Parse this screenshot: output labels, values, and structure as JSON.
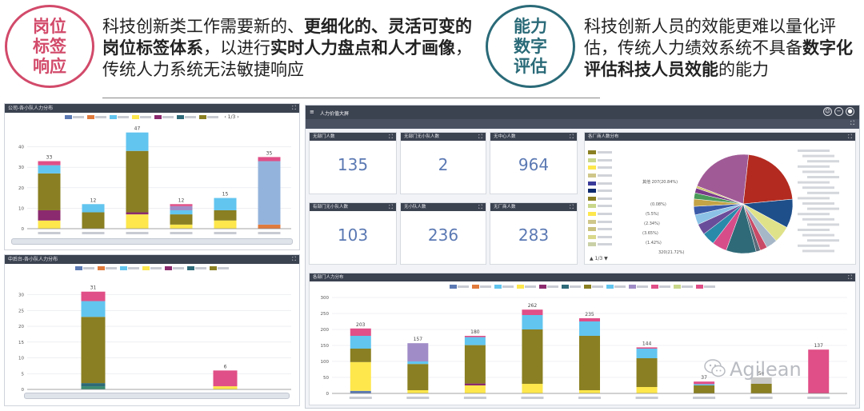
{
  "header": {
    "left_badge": "岗位\n标签\n响应",
    "left_text": [
      "科技创新类工作需要新的、",
      "更细化的、灵活可变的岗位标签体系",
      "，以进行",
      "实时人力盘点和人才画像",
      "，传统人力系统无法敏捷响应"
    ],
    "right_badge": "能力\n数字\n评估",
    "right_text": [
      "科技创新人员的效能更难以量化评估，传统人力绩效系统不具备",
      "数字化评估科技人员效能",
      "的能力"
    ],
    "colors": {
      "left": "#d24a6a",
      "right": "#2a6a78"
    }
  },
  "panels": {
    "top_left": {
      "title": "公司-各小队人力分布",
      "pager": "1/3",
      "chart_data": {
        "type": "bar",
        "stacked": true,
        "ylim": [
          0,
          50
        ],
        "yticks": [
          0,
          10,
          20,
          30,
          40
        ],
        "total_labels": [
          "33",
          "12",
          "47",
          "12",
          "15",
          "35"
        ],
        "bars": [
          {
            "segments": [
              [
                4,
                "#fde74c"
              ],
              [
                5,
                "#8b2a6e"
              ],
              [
                18,
                "#8a7f22"
              ],
              [
                4,
                "#62c5ef"
              ],
              [
                2,
                "#e04f87"
              ]
            ]
          },
          {
            "segments": [
              [
                8,
                "#8a7f22"
              ],
              [
                4,
                "#62c5ef"
              ]
            ]
          },
          {
            "segments": [
              [
                7,
                "#fde74c"
              ],
              [
                1,
                "#8b2a6e"
              ],
              [
                30,
                "#8a7f22"
              ],
              [
                9,
                "#62c5ef"
              ]
            ]
          },
          {
            "segments": [
              [
                2,
                "#fde74c"
              ],
              [
                5,
                "#8a7f22"
              ],
              [
                2,
                "#62c5ef"
              ],
              [
                2,
                "#a08cc7"
              ],
              [
                1,
                "#e04f87"
              ]
            ]
          },
          {
            "segments": [
              [
                4,
                "#fde74c"
              ],
              [
                5,
                "#8a7f22"
              ],
              [
                6,
                "#62c5ef"
              ]
            ]
          },
          {
            "segments": [
              [
                2,
                "#e07a3c"
              ],
              [
                31,
                "#94b3dc"
              ],
              [
                2,
                "#e04f87"
              ]
            ]
          }
        ]
      }
    },
    "bottom_left": {
      "title": "中后台-各小队人力分布",
      "chart_data": {
        "type": "bar",
        "stacked": true,
        "ylim": [
          0,
          36
        ],
        "yticks": [
          0,
          5,
          10,
          15,
          20,
          25,
          30
        ],
        "total_labels": [
          "31",
          "6"
        ],
        "bars": [
          {
            "segments": [
              [
                1,
                "#3a8a72"
              ],
              [
                1,
                "#2e6a78"
              ],
              [
                21,
                "#8a7f22"
              ],
              [
                5,
                "#62c5ef"
              ],
              [
                3,
                "#e04f87"
              ]
            ]
          },
          {
            "segments": [
              [
                1,
                "#fde74c"
              ],
              [
                5,
                "#e04f87"
              ]
            ]
          }
        ]
      }
    },
    "dash": {
      "title": "人力价值大屏",
      "kpis": [
        {
          "title": "无部门人数",
          "value": "135"
        },
        {
          "title": "无部门无小队人数",
          "value": "2"
        },
        {
          "title": "无中心人数",
          "value": "964"
        },
        {
          "title": "有部门无小队人数",
          "value": "103"
        },
        {
          "title": "无小队人数",
          "value": "236"
        },
        {
          "title": "无厂商人数",
          "value": "283"
        }
      ],
      "pie": {
        "title": "各厂商人数分布",
        "pager": "1/3",
        "labels": [
          "其他 207(20.84%)",
          "320(21.72%)",
          "(0.08%)",
          "(5.5%)",
          "(2.34%)",
          "(3.65%)",
          "(1.42%)"
        ],
        "legend_colors": [
          "#8a7f22",
          "#c8d78a",
          "#fde74c",
          "#cfc68a",
          "#3a3a9a",
          "#0e2a6e",
          "#8a7f22",
          "#c8d78a",
          "#fde74c",
          "#cfc68a",
          "#c9c27e",
          "#d9d88a",
          "#c9d0a6"
        ],
        "chart_data": {
          "type": "pie",
          "values": [
            20.84,
            21.72,
            9.4,
            5.5,
            3.65,
            2.34,
            1.42,
            9.8,
            4.8,
            4.2,
            3.6,
            3.2,
            2.8,
            2.4,
            2.0,
            1.6,
            0.7
          ],
          "colors": [
            "#a05b96",
            "#b32a20",
            "#1f4f8a",
            "#e0e28a",
            "#a6b7c8",
            "#c94a66",
            "#5a6a7a",
            "#2f6a78",
            "#d64d8a",
            "#2a8aaa",
            "#6a4d9a",
            "#8bc2e6",
            "#3a5aa8",
            "#c4a446",
            "#4a9a5a",
            "#7a3a8a",
            "#cfc26a"
          ]
        }
      },
      "bottom": {
        "title": "各部门人力分布",
        "chart_data": {
          "type": "bar",
          "stacked": true,
          "ylim": [
            0,
            310
          ],
          "yticks": [
            0,
            50,
            100,
            150,
            200,
            250,
            300
          ],
          "total_labels": [
            "203",
            "157",
            "180",
            "262",
            "235",
            "144",
            "37",
            "50",
            "137"
          ],
          "bars": [
            {
              "segments": [
                [
                  8,
                  "#5b79b3"
                ],
                [
                  90,
                  "#fde74c"
                ],
                [
                  42,
                  "#8a7f22"
                ],
                [
                  40,
                  "#62c5ef"
                ],
                [
                  23,
                  "#e04f87"
                ]
              ]
            },
            {
              "segments": [
                [
                  10,
                  "#fde74c"
                ],
                [
                  82,
                  "#8a7f22"
                ],
                [
                  8,
                  "#62c5ef"
                ],
                [
                  57,
                  "#a08cc7"
                ]
              ]
            },
            {
              "segments": [
                [
                  25,
                  "#fde74c"
                ],
                [
                  6,
                  "#8b2a6e"
                ],
                [
                  120,
                  "#8a7f22"
                ],
                [
                  25,
                  "#62c5ef"
                ],
                [
                  4,
                  "#e04f87"
                ]
              ]
            },
            {
              "segments": [
                [
                  30,
                  "#fde74c"
                ],
                [
                  170,
                  "#8a7f22"
                ],
                [
                  45,
                  "#62c5ef"
                ],
                [
                  17,
                  "#e04f87"
                ]
              ]
            },
            {
              "segments": [
                [
                  10,
                  "#fde74c"
                ],
                [
                  170,
                  "#8a7f22"
                ],
                [
                  45,
                  "#62c5ef"
                ],
                [
                  10,
                  "#e04f87"
                ]
              ]
            },
            {
              "segments": [
                [
                  20,
                  "#fde74c"
                ],
                [
                  90,
                  "#8a7f22"
                ],
                [
                  30,
                  "#62c5ef"
                ],
                [
                  4,
                  "#e04f87"
                ]
              ]
            },
            {
              "segments": [
                [
                  25,
                  "#8a7f22"
                ],
                [
                  4,
                  "#62c5ef"
                ],
                [
                  8,
                  "#e04f87"
                ]
              ]
            },
            {
              "segments": [
                [
                  30,
                  "#8a7f22"
                ],
                [
                  20,
                  "#c8c8c8"
                ]
              ]
            },
            {
              "segments": [
                [
                  137,
                  "#e04f87"
                ]
              ]
            }
          ]
        }
      }
    }
  },
  "watermark": "Agilean"
}
